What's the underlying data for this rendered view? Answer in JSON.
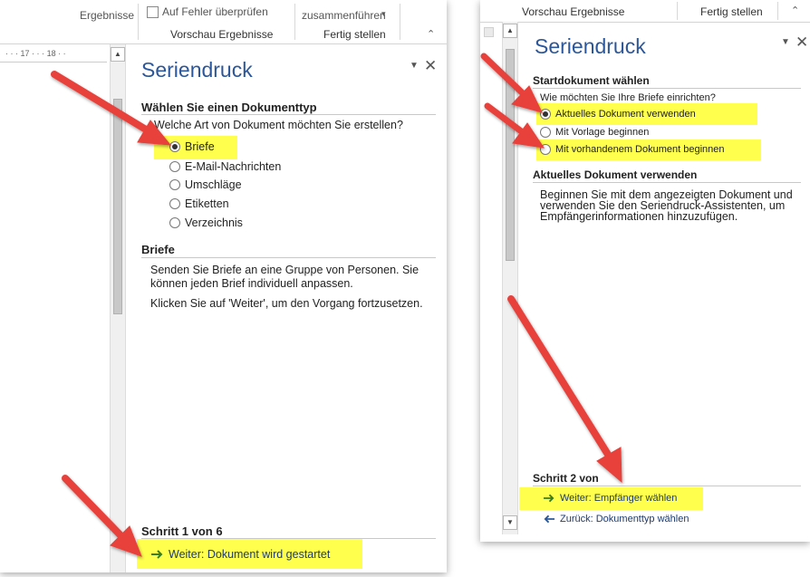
{
  "left": {
    "ribbon": {
      "item_ergebnisse": "Ergebnisse",
      "item_auf_fehler": "Auf Fehler überprüfen",
      "item_zusammenfuehren": "zusammenführen",
      "group_vorschau": "Vorschau Ergebnisse",
      "group_fertig": "Fertig stellen"
    },
    "ruler": {
      "mark_17": "17",
      "mark_18": "18"
    },
    "pane": {
      "title": "Seriendruck",
      "section_doc_type": {
        "heading": "Wählen Sie einen Dokumenttyp",
        "question": "Welche Art von Dokument möchten Sie erstellen?",
        "options": [
          {
            "label": "Briefe",
            "selected": true
          },
          {
            "label": "E-Mail-Nachrichten",
            "selected": false
          },
          {
            "label": "Umschläge",
            "selected": false
          },
          {
            "label": "Etiketten",
            "selected": false
          },
          {
            "label": "Verzeichnis",
            "selected": false
          }
        ]
      },
      "section_briefe": {
        "heading": "Briefe",
        "text_line1": "Senden Sie Briefe an eine Gruppe von Personen. Sie",
        "text_line2": "können jeden Brief individuell anpassen.",
        "text_continue": "Klicken Sie auf 'Weiter', um den Vorgang fortzusetzen."
      },
      "step": "Schritt 1 von 6",
      "next_link": "Weiter: Dokument wird gestartet"
    }
  },
  "right": {
    "ribbon": {
      "group_vorschau": "Vorschau Ergebnisse",
      "group_fertig": "Fertig stellen"
    },
    "pane": {
      "title": "Seriendruck",
      "section_start": {
        "heading": "Startdokument wählen",
        "question": "Wie möchten Sie Ihre Briefe einrichten?",
        "options": [
          {
            "label": "Aktuelles Dokument verwenden",
            "selected": true
          },
          {
            "label": "Mit Vorlage beginnen",
            "selected": false
          },
          {
            "label": "Mit vorhandenem Dokument beginnen",
            "selected": false
          }
        ]
      },
      "section_current": {
        "heading": "Aktuelles Dokument verwenden",
        "line1": "Beginnen Sie mit dem angezeigten Dokument und",
        "line2": "verwenden Sie den Seriendruck-Assistenten, um",
        "line3": "Empfängerinformationen hinzuzufügen."
      },
      "step": "Schritt 2 von",
      "next_link": "Weiter: Empfänger wählen",
      "back_link": "Zurück: Dokumenttyp wählen"
    }
  },
  "colors": {
    "title_blue": "#2b579a",
    "highlight": "#ffff4d",
    "callout_red": "#e8413a",
    "next_arrow_green": "#3a7d1e",
    "back_arrow_blue": "#2b579a"
  },
  "icons": {
    "pane_menu": "dropdown-triangle-icon",
    "pane_close": "close-icon",
    "scroll_up": "scroll-up-icon",
    "scroll_down": "scroll-down-icon",
    "next": "arrow-right-icon",
    "back": "arrow-left-icon",
    "checkbox": "checkbox-icon"
  }
}
